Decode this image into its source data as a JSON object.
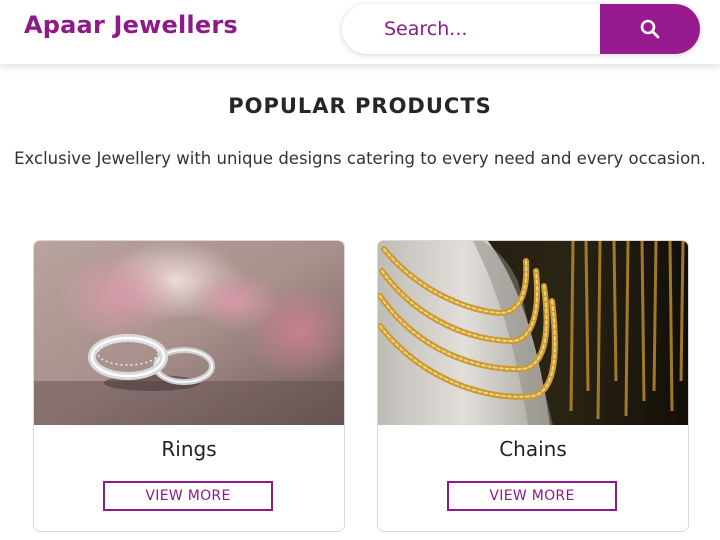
{
  "header": {
    "logo": "Apaar Jewellers",
    "search": {
      "placeholder": "Search...",
      "icon": "search-icon"
    }
  },
  "section": {
    "title": "POPULAR PRODUCTS",
    "description": "Exclusive Jewellery with unique designs catering to every need and every occasion."
  },
  "products": [
    {
      "name": "Rings",
      "button": "VIEW MORE"
    },
    {
      "name": "Chains",
      "button": "VIEW MORE"
    }
  ],
  "colors": {
    "brand": "#8e1a8a",
    "search_button": "#971b8f"
  }
}
